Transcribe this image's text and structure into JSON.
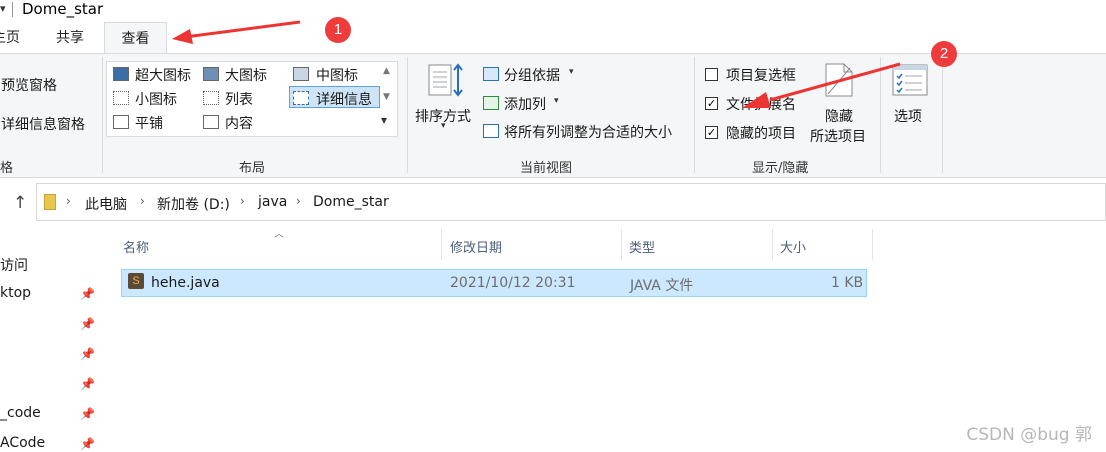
{
  "window": {
    "title": "Dome_star"
  },
  "tabs": [
    {
      "label": "主页"
    },
    {
      "label": "共享"
    },
    {
      "label": "查看"
    }
  ],
  "ribbon": {
    "panes": {
      "preview": "预览窗格",
      "details": "详细信息窗格",
      "group_label": "窗格"
    },
    "layout": {
      "items": [
        {
          "label": "超大图标"
        },
        {
          "label": "大图标"
        },
        {
          "label": "中图标"
        },
        {
          "label": "小图标"
        },
        {
          "label": "列表"
        },
        {
          "label": "详细信息"
        },
        {
          "label": "平铺"
        },
        {
          "label": "内容"
        }
      ],
      "group_label": "布局",
      "selected": "详细信息"
    },
    "current_view": {
      "sort_by": "排序方式",
      "group_by": "分组依据",
      "add_columns": "添加列",
      "fit_columns": "将所有列调整为合适的大小",
      "group_label": "当前视图"
    },
    "show_hide": {
      "item_checkboxes": {
        "label": "项目复选框",
        "checked": false
      },
      "file_extensions": {
        "label": "文件扩展名",
        "checked": true
      },
      "hidden_items": {
        "label": "隐藏的项目",
        "checked": true
      },
      "hide_selected_line1": "隐藏",
      "hide_selected_line2": "所选项目",
      "group_label": "显示/隐藏"
    },
    "options": "选项"
  },
  "address": {
    "crumbs": [
      "此电脑",
      "新加卷 (D:)",
      "java",
      "Dome_star"
    ]
  },
  "nav": {
    "items": [
      {
        "label": "访问"
      },
      {
        "label": "ktop"
      },
      {
        "label": ""
      },
      {
        "label": ""
      },
      {
        "label": ""
      },
      {
        "label": "_code"
      },
      {
        "label": "ACode"
      }
    ]
  },
  "list": {
    "columns": [
      "名称",
      "修改日期",
      "类型",
      "大小"
    ],
    "rows": [
      {
        "name": "hehe.java",
        "modified": "2021/10/12 20:31",
        "type": "JAVA 文件",
        "size": "1 KB"
      }
    ]
  },
  "annotations": {
    "badge1": "1",
    "badge2": "2",
    "arrow_color": "#ee3333"
  },
  "watermark": "CSDN @bug 郭",
  "colors": {
    "selection": "#cce8ff",
    "selection_border": "#99d1ff",
    "ribbon_bg": "#f5f6f7",
    "badge": "#ef3b3b"
  }
}
